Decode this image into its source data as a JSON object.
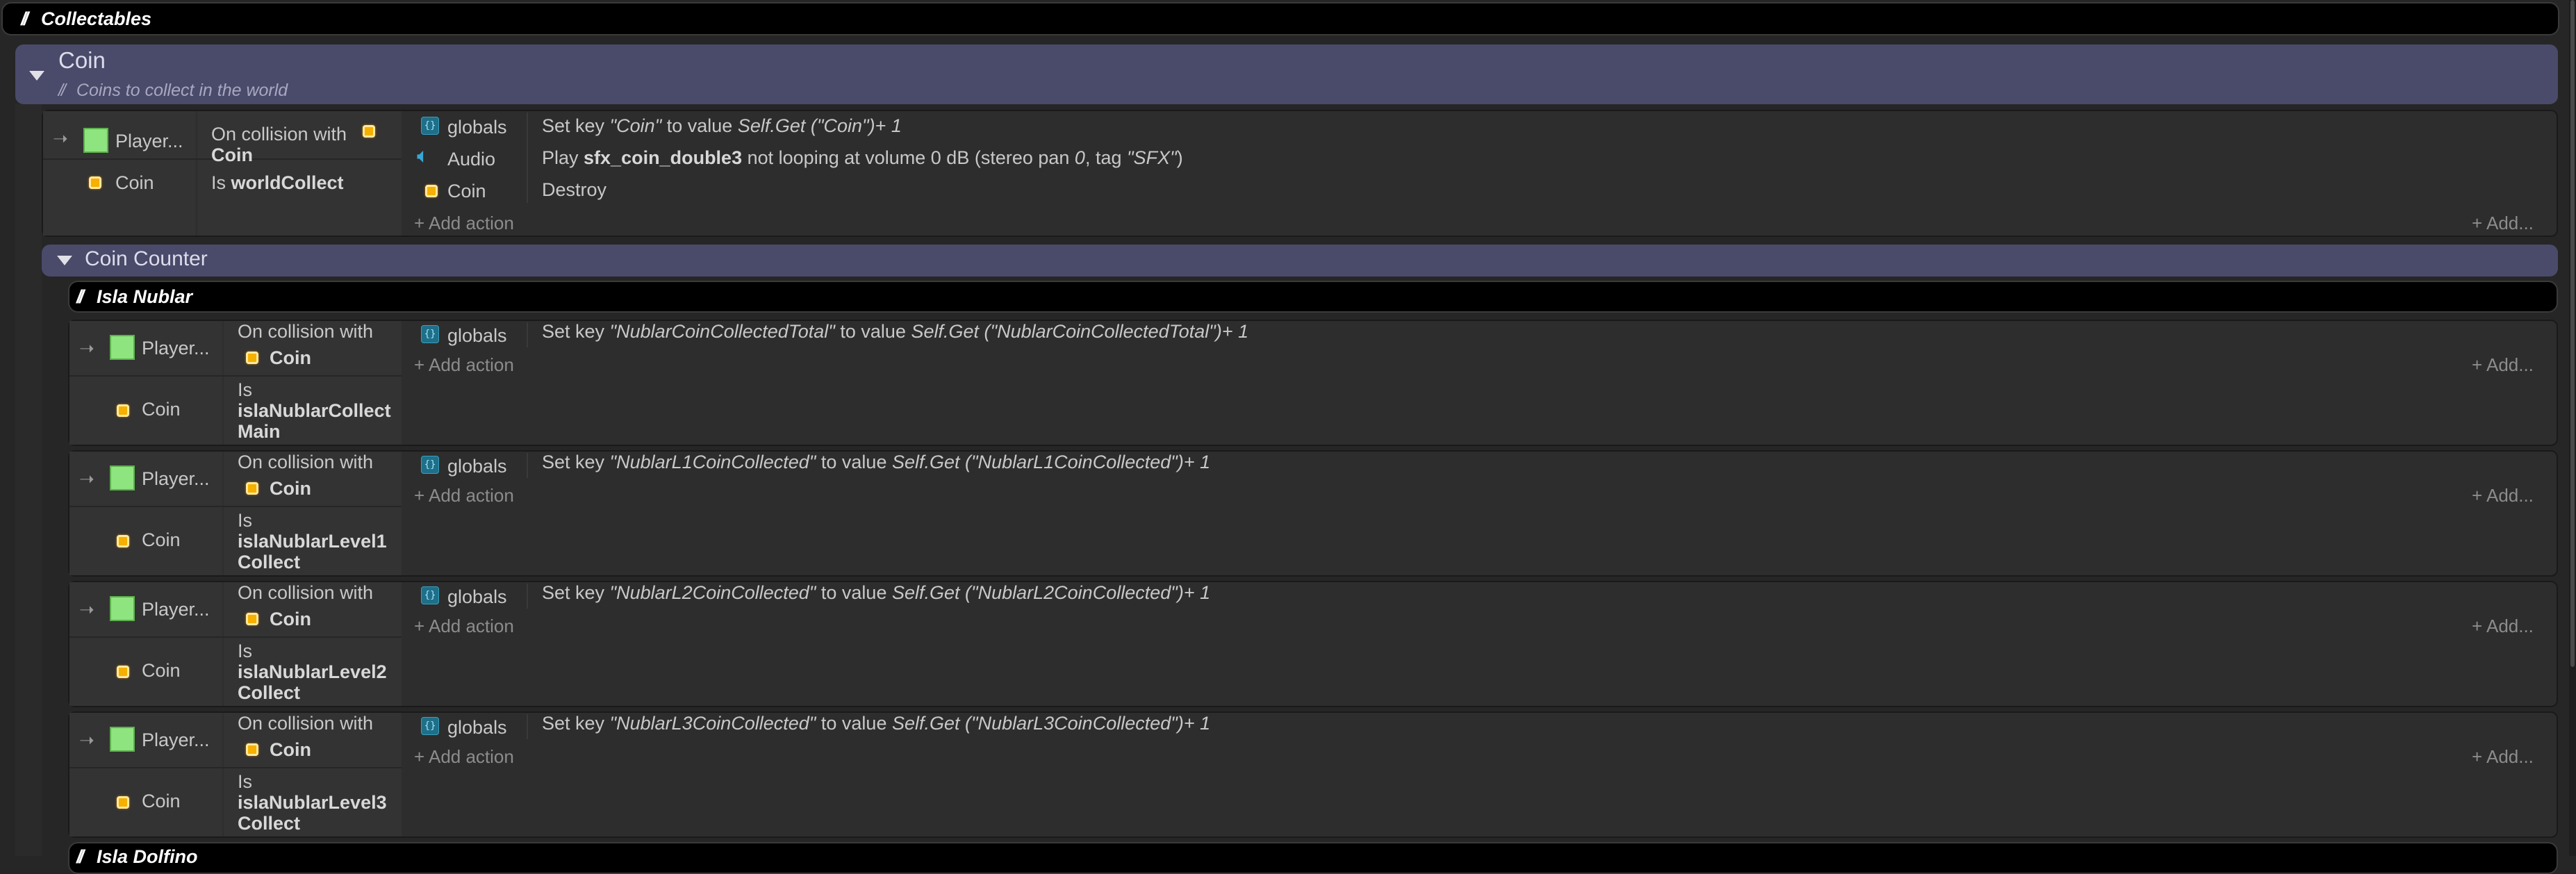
{
  "collectables": {
    "title": "Collectables"
  },
  "coin_group": {
    "title": "Coin",
    "description": "Coins to collect in the world"
  },
  "coin_event": {
    "player_label": "Player...",
    "coin_label": "Coin",
    "cond1_prefix": "On collision with",
    "cond1_object": "Coin",
    "cond2_prefix": "Is",
    "cond2_value": "worldCollect",
    "actions": [
      {
        "object": "globals",
        "pre": "Set key ",
        "key": "\"Coin\"",
        "mid": " to value ",
        "expr": "Self.Get (\"Coin\")+ 1"
      },
      {
        "object": "Audio",
        "pre": "Play ",
        "sound": "sfx_coin_double3",
        "mid": " not looping at volume 0 dB (stereo pan ",
        "pan": "0",
        "mid2": ", tag ",
        "tag": "\"SFX\"",
        "end": ")"
      },
      {
        "object": "Coin",
        "text": "Destroy"
      }
    ],
    "add_action": "+ Add action",
    "add": "+ Add..."
  },
  "counter_group": {
    "title": "Coin Counter"
  },
  "isla_nublar": {
    "title": "Isla Nublar"
  },
  "isla_dolfino": {
    "title": "Isla Dolfino"
  },
  "counter_events": [
    {
      "player_label": "Player...",
      "coin_label": "Coin",
      "cond1_prefix": "On collision with",
      "cond1_object": "Coin",
      "cond2_prefix": "Is",
      "cond2_line1": "islaNublarCollect",
      "cond2_line2": "Main",
      "object": "globals",
      "pre": "Set key ",
      "key": "\"NublarCoinCollectedTotal\"",
      "mid": " to value ",
      "expr": "Self.Get (\"NublarCoinCollectedTotal\")+ 1",
      "add_action": "+ Add action",
      "add": "+ Add..."
    },
    {
      "player_label": "Player...",
      "coin_label": "Coin",
      "cond1_prefix": "On collision with",
      "cond1_object": "Coin",
      "cond2_prefix": "Is",
      "cond2_line1": "islaNublarLevel1",
      "cond2_line2": "Collect",
      "object": "globals",
      "pre": "Set key ",
      "key": "\"NublarL1CoinCollected\"",
      "mid": " to value ",
      "expr": "Self.Get (\"NublarL1CoinCollected\")+ 1",
      "add_action": "+ Add action",
      "add": "+ Add..."
    },
    {
      "player_label": "Player...",
      "coin_label": "Coin",
      "cond1_prefix": "On collision with",
      "cond1_object": "Coin",
      "cond2_prefix": "Is",
      "cond2_line1": "islaNublarLevel2",
      "cond2_line2": "Collect",
      "object": "globals",
      "pre": "Set key ",
      "key": "\"NublarL2CoinCollected\"",
      "mid": " to value ",
      "expr": "Self.Get (\"NublarL2CoinCollected\")+ 1",
      "add_action": "+ Add action",
      "add": "+ Add..."
    },
    {
      "player_label": "Player...",
      "coin_label": "Coin",
      "cond1_prefix": "On collision with",
      "cond1_object": "Coin",
      "cond2_prefix": "Is",
      "cond2_line1": "islaNublarLevel3",
      "cond2_line2": "Collect",
      "object": "globals",
      "pre": "Set key ",
      "key": "\"NublarL3CoinCollected\"",
      "mid": " to value ",
      "expr": "Self.Get (\"NublarL3CoinCollected\")+ 1",
      "add_action": "+ Add action",
      "add": "+ Add..."
    }
  ],
  "icons": {
    "comment": "comment-slash-icon",
    "collapse": "collapse-triangle-icon",
    "trigger": "trigger-arrow-icon",
    "globals": "globals-dictionary-icon",
    "audio": "audio-speaker-icon",
    "coin": "coin-sprite-icon",
    "player": "player-sprite-icon"
  },
  "colors": {
    "group": "#4a4a6a",
    "comment": "#000000",
    "event_bg": "#2d2d2d",
    "player": "#8ee47e",
    "coin": "#f5b000"
  }
}
